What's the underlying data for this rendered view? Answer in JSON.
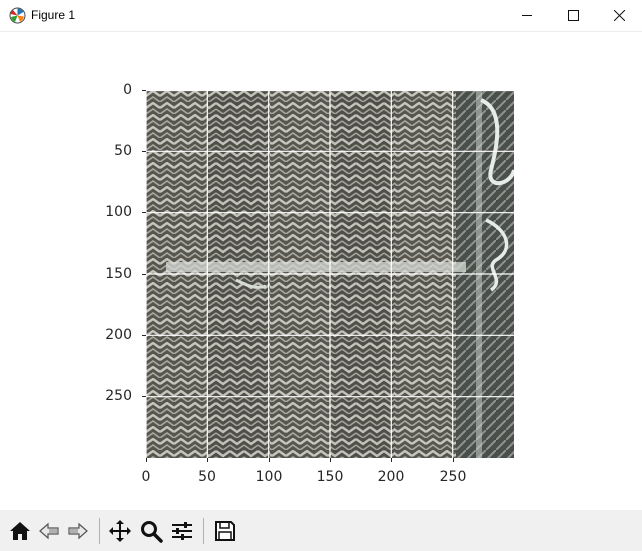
{
  "window": {
    "title": "Figure 1",
    "icons": [
      "matplotlib-icon",
      "minimize-icon",
      "maximize-icon",
      "close-icon"
    ]
  },
  "axes": {
    "yticks": [
      "0",
      "50",
      "100",
      "150",
      "200",
      "250"
    ],
    "xticks": [
      "0",
      "50",
      "100",
      "150",
      "200",
      "250"
    ],
    "image_content": "herringbone tweed fabric photo",
    "grid": true,
    "grid_color": "#ffffff"
  },
  "toolbar": {
    "icons": [
      "home-icon",
      "back-icon",
      "forward-icon",
      "pan-icon",
      "zoom-icon",
      "configure-subplots-icon",
      "save-icon"
    ]
  },
  "colors": {
    "fabric_dark": "#55554f",
    "fabric_light": "#c9c9c0",
    "thread_highlight": "#e6ece8"
  }
}
